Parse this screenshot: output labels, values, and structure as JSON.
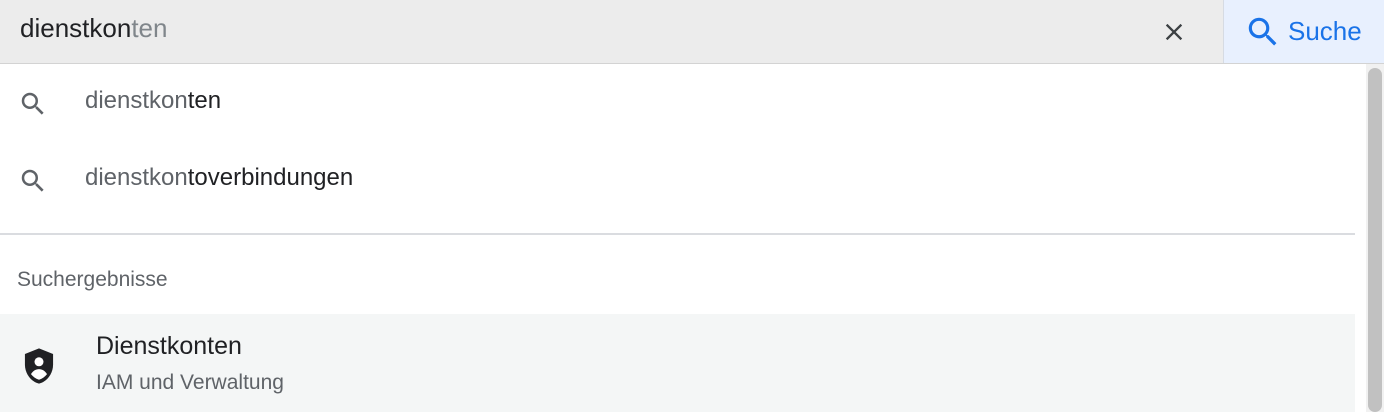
{
  "search": {
    "query_typed": "dienstkon",
    "query_completion": "ten",
    "clear_icon": "close-icon",
    "button_icon": "search-icon",
    "button_label": "Suche"
  },
  "suggestions": [
    {
      "icon": "search-icon",
      "typed": "dienstkon",
      "completion": "ten"
    },
    {
      "icon": "search-icon",
      "typed": "dienstkon",
      "completion": "toverbindungen"
    }
  ],
  "results_section": {
    "heading": "Suchergebnisse",
    "items": [
      {
        "icon": "shield-person-icon",
        "title": "Dienstkonten",
        "subtitle": "IAM und Verwaltung"
      }
    ]
  },
  "colors": {
    "accent": "#1a73e8",
    "search_bar_bg": "#ececec",
    "search_button_bg": "#e8f0fe",
    "highlight_row_bg": "#f4f6f6"
  }
}
